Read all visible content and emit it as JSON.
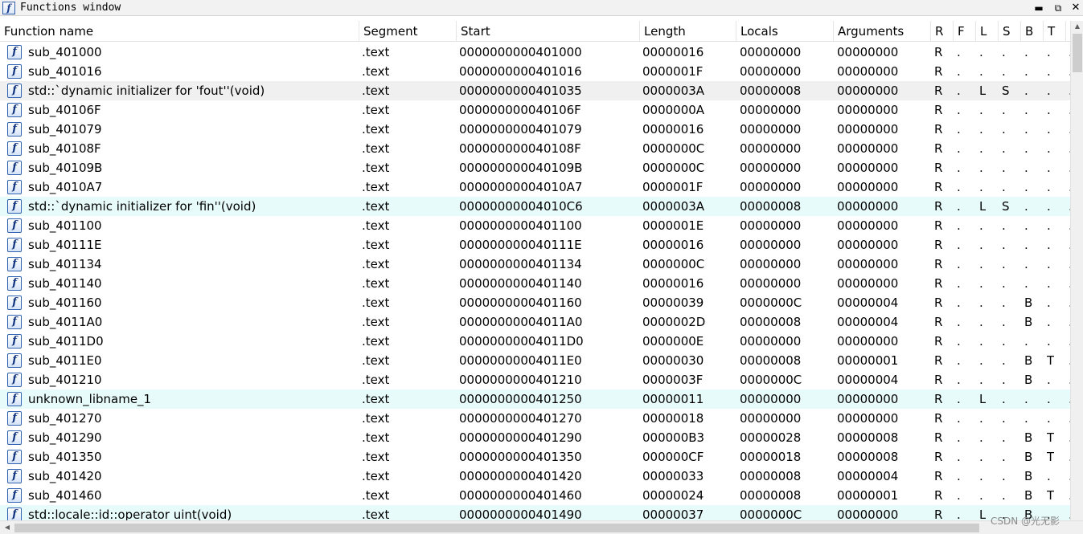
{
  "window": {
    "title": "Functions window",
    "icon": "function-icon",
    "minimize_glyph": "▬",
    "restore_glyph": "⧉",
    "close_glyph": "✕"
  },
  "columns": [
    {
      "key": "name",
      "label": "Function name"
    },
    {
      "key": "segment",
      "label": "Segment"
    },
    {
      "key": "start",
      "label": "Start"
    },
    {
      "key": "length",
      "label": "Length"
    },
    {
      "key": "locals",
      "label": "Locals"
    },
    {
      "key": "arguments",
      "label": "Arguments"
    },
    {
      "key": "r",
      "label": "R"
    },
    {
      "key": "f",
      "label": "F"
    },
    {
      "key": "l",
      "label": "L"
    },
    {
      "key": "s",
      "label": "S"
    },
    {
      "key": "b",
      "label": "B"
    },
    {
      "key": "t",
      "label": "T"
    },
    {
      "key": "extra",
      "label": "."
    }
  ],
  "rows": [
    {
      "name": "sub_401000",
      "segment": ".text",
      "start": "0000000000401000",
      "length": "00000016",
      "locals": "00000000",
      "arguments": "00000000",
      "r": "R",
      "f": ".",
      "l": ".",
      "s": ".",
      "b": ".",
      "t": ".",
      "extra": ".",
      "highlight": "none"
    },
    {
      "name": "sub_401016",
      "segment": ".text",
      "start": "0000000000401016",
      "length": "0000001F",
      "locals": "00000000",
      "arguments": "00000000",
      "r": "R",
      "f": ".",
      "l": ".",
      "s": ".",
      "b": ".",
      "t": ".",
      "extra": ".",
      "highlight": "none"
    },
    {
      "name": "std::`dynamic initializer for 'fout''(void)",
      "segment": ".text",
      "start": "0000000000401035",
      "length": "0000003A",
      "locals": "00000008",
      "arguments": "00000000",
      "r": "R",
      "f": ".",
      "l": "L",
      "s": "S",
      "b": ".",
      "t": ".",
      "extra": ".",
      "highlight": "gray"
    },
    {
      "name": "sub_40106F",
      "segment": ".text",
      "start": "000000000040106F",
      "length": "0000000A",
      "locals": "00000000",
      "arguments": "00000000",
      "r": "R",
      "f": ".",
      "l": ".",
      "s": ".",
      "b": ".",
      "t": ".",
      "extra": ".",
      "highlight": "none"
    },
    {
      "name": "sub_401079",
      "segment": ".text",
      "start": "0000000000401079",
      "length": "00000016",
      "locals": "00000000",
      "arguments": "00000000",
      "r": "R",
      "f": ".",
      "l": ".",
      "s": ".",
      "b": ".",
      "t": ".",
      "extra": ".",
      "highlight": "none"
    },
    {
      "name": "sub_40108F",
      "segment": ".text",
      "start": "000000000040108F",
      "length": "0000000C",
      "locals": "00000000",
      "arguments": "00000000",
      "r": "R",
      "f": ".",
      "l": ".",
      "s": ".",
      "b": ".",
      "t": ".",
      "extra": ".",
      "highlight": "none"
    },
    {
      "name": "sub_40109B",
      "segment": ".text",
      "start": "000000000040109B",
      "length": "0000000C",
      "locals": "00000000",
      "arguments": "00000000",
      "r": "R",
      "f": ".",
      "l": ".",
      "s": ".",
      "b": ".",
      "t": ".",
      "extra": ".",
      "highlight": "none"
    },
    {
      "name": "sub_4010A7",
      "segment": ".text",
      "start": "00000000004010A7",
      "length": "0000001F",
      "locals": "00000000",
      "arguments": "00000000",
      "r": "R",
      "f": ".",
      "l": ".",
      "s": ".",
      "b": ".",
      "t": ".",
      "extra": ".",
      "highlight": "none"
    },
    {
      "name": "std::`dynamic initializer for 'fin''(void)",
      "segment": ".text",
      "start": "00000000004010C6",
      "length": "0000003A",
      "locals": "00000008",
      "arguments": "00000000",
      "r": "R",
      "f": ".",
      "l": "L",
      "s": "S",
      "b": ".",
      "t": ".",
      "extra": ".",
      "highlight": "cyan"
    },
    {
      "name": "sub_401100",
      "segment": ".text",
      "start": "0000000000401100",
      "length": "0000001E",
      "locals": "00000000",
      "arguments": "00000000",
      "r": "R",
      "f": ".",
      "l": ".",
      "s": ".",
      "b": ".",
      "t": ".",
      "extra": ".",
      "highlight": "none"
    },
    {
      "name": "sub_40111E",
      "segment": ".text",
      "start": "000000000040111E",
      "length": "00000016",
      "locals": "00000000",
      "arguments": "00000000",
      "r": "R",
      "f": ".",
      "l": ".",
      "s": ".",
      "b": ".",
      "t": ".",
      "extra": ".",
      "highlight": "none"
    },
    {
      "name": "sub_401134",
      "segment": ".text",
      "start": "0000000000401134",
      "length": "0000000C",
      "locals": "00000000",
      "arguments": "00000000",
      "r": "R",
      "f": ".",
      "l": ".",
      "s": ".",
      "b": ".",
      "t": ".",
      "extra": ".",
      "highlight": "none"
    },
    {
      "name": "sub_401140",
      "segment": ".text",
      "start": "0000000000401140",
      "length": "00000016",
      "locals": "00000000",
      "arguments": "00000000",
      "r": "R",
      "f": ".",
      "l": ".",
      "s": ".",
      "b": ".",
      "t": ".",
      "extra": ".",
      "highlight": "none"
    },
    {
      "name": "sub_401160",
      "segment": ".text",
      "start": "0000000000401160",
      "length": "00000039",
      "locals": "0000000C",
      "arguments": "00000004",
      "r": "R",
      "f": ".",
      "l": ".",
      "s": ".",
      "b": "B",
      "t": ".",
      "extra": ".",
      "highlight": "none"
    },
    {
      "name": "sub_4011A0",
      "segment": ".text",
      "start": "00000000004011A0",
      "length": "0000002D",
      "locals": "00000008",
      "arguments": "00000004",
      "r": "R",
      "f": ".",
      "l": ".",
      "s": ".",
      "b": "B",
      "t": ".",
      "extra": ".",
      "highlight": "none"
    },
    {
      "name": "sub_4011D0",
      "segment": ".text",
      "start": "00000000004011D0",
      "length": "0000000E",
      "locals": "00000000",
      "arguments": "00000000",
      "r": "R",
      "f": ".",
      "l": ".",
      "s": ".",
      "b": ".",
      "t": ".",
      "extra": ".",
      "highlight": "none"
    },
    {
      "name": "sub_4011E0",
      "segment": ".text",
      "start": "00000000004011E0",
      "length": "00000030",
      "locals": "00000008",
      "arguments": "00000001",
      "r": "R",
      "f": ".",
      "l": ".",
      "s": ".",
      "b": "B",
      "t": "T",
      "extra": ".",
      "highlight": "none"
    },
    {
      "name": "sub_401210",
      "segment": ".text",
      "start": "0000000000401210",
      "length": "0000003F",
      "locals": "0000000C",
      "arguments": "00000004",
      "r": "R",
      "f": ".",
      "l": ".",
      "s": ".",
      "b": "B",
      "t": ".",
      "extra": ".",
      "highlight": "none"
    },
    {
      "name": "unknown_libname_1",
      "segment": ".text",
      "start": "0000000000401250",
      "length": "00000011",
      "locals": "00000000",
      "arguments": "00000000",
      "r": "R",
      "f": ".",
      "l": "L",
      "s": ".",
      "b": ".",
      "t": ".",
      "extra": ".",
      "highlight": "cyan"
    },
    {
      "name": "sub_401270",
      "segment": ".text",
      "start": "0000000000401270",
      "length": "00000018",
      "locals": "00000000",
      "arguments": "00000000",
      "r": "R",
      "f": ".",
      "l": ".",
      "s": ".",
      "b": ".",
      "t": ".",
      "extra": ".",
      "highlight": "none"
    },
    {
      "name": "sub_401290",
      "segment": ".text",
      "start": "0000000000401290",
      "length": "000000B3",
      "locals": "00000028",
      "arguments": "00000008",
      "r": "R",
      "f": ".",
      "l": ".",
      "s": ".",
      "b": "B",
      "t": "T",
      "extra": ".",
      "highlight": "none"
    },
    {
      "name": "sub_401350",
      "segment": ".text",
      "start": "0000000000401350",
      "length": "000000CF",
      "locals": "00000018",
      "arguments": "00000008",
      "r": "R",
      "f": ".",
      "l": ".",
      "s": ".",
      "b": "B",
      "t": "T",
      "extra": ".",
      "highlight": "none"
    },
    {
      "name": "sub_401420",
      "segment": ".text",
      "start": "0000000000401420",
      "length": "00000033",
      "locals": "00000008",
      "arguments": "00000004",
      "r": "R",
      "f": ".",
      "l": ".",
      "s": ".",
      "b": "B",
      "t": ".",
      "extra": ".",
      "highlight": "none"
    },
    {
      "name": "sub_401460",
      "segment": ".text",
      "start": "0000000000401460",
      "length": "00000024",
      "locals": "00000008",
      "arguments": "00000001",
      "r": "R",
      "f": ".",
      "l": ".",
      "s": ".",
      "b": "B",
      "t": "T",
      "extra": ".",
      "highlight": "none"
    },
    {
      "name": "std::locale::id::operator uint(void)",
      "segment": ".text",
      "start": "0000000000401490",
      "length": "00000037",
      "locals": "0000000C",
      "arguments": "00000000",
      "r": "R",
      "f": ".",
      "l": "L",
      "s": ".",
      "b": "B",
      "t": ".",
      "extra": ".",
      "highlight": "cyan"
    }
  ],
  "watermark": "CSDN @光无影",
  "colors": {
    "row_highlight_gray": "#f0f0f0",
    "row_highlight_cyan": "#e8fbfb",
    "icon_border": "#2f62b3"
  }
}
